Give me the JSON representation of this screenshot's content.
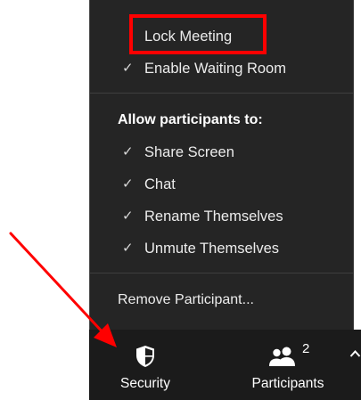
{
  "menu": {
    "top_items": [
      {
        "label": "Lock Meeting",
        "checked": false
      },
      {
        "label": "Enable Waiting Room",
        "checked": true
      }
    ],
    "section_title": "Allow participants to:",
    "permissions": [
      {
        "label": "Share Screen",
        "checked": true
      },
      {
        "label": "Chat",
        "checked": true
      },
      {
        "label": "Rename Themselves",
        "checked": true
      },
      {
        "label": "Unmute Themselves",
        "checked": true
      }
    ],
    "remove_label": "Remove Participant...",
    "check_glyph": "✓"
  },
  "toolbar": {
    "security_label": "Security",
    "participants_label": "Participants",
    "participants_count": "2"
  },
  "icons": {
    "security": "shield-icon",
    "participants": "people-icon",
    "more": "caret-up-icon"
  },
  "colors": {
    "menu_bg": "#252525",
    "toolbar_bg": "#1b1b1b",
    "annotation_red": "#ff0000"
  }
}
